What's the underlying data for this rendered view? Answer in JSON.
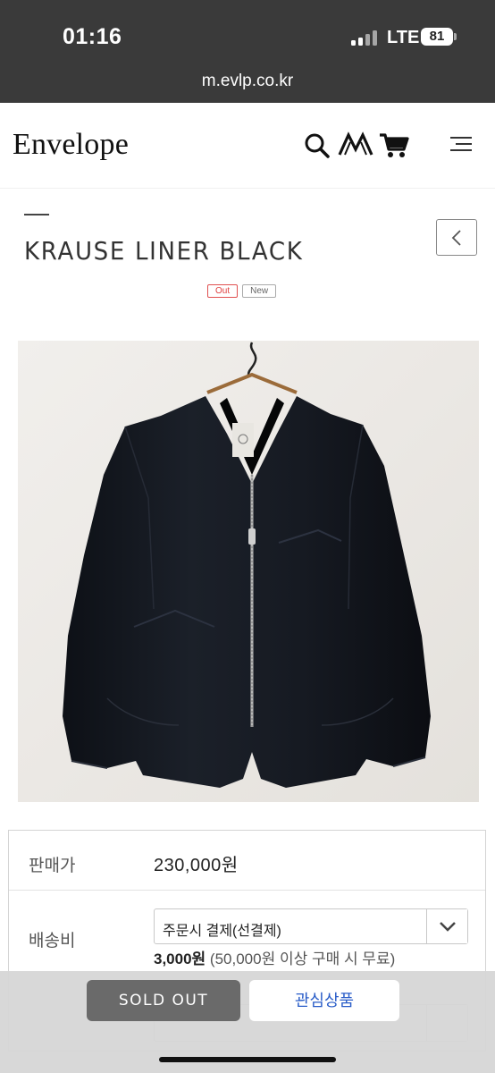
{
  "status_bar": {
    "time": "01:16",
    "network": "LTE",
    "battery": "81"
  },
  "browser": {
    "url": "m.evlp.co.kr"
  },
  "header": {
    "logo": "Envelope",
    "icons": [
      "search-icon",
      "brand-logo-icon",
      "cart-icon",
      "menu-icon"
    ]
  },
  "product": {
    "title": "KRAUSE LINER BLACK",
    "badges": {
      "out": "Out",
      "new": "New"
    },
    "image_alt": "black v-neck zip liner jacket on hanger"
  },
  "info": {
    "price_label": "판매가",
    "price_value": "230,000원",
    "shipping_label": "배송비",
    "shipping_option": "주문시 결제(선결제)",
    "shipping_fee": "3,000원",
    "shipping_note": "(50,000원 이상 구매 시 무료)"
  },
  "actions": {
    "soldout": "SOLD OUT",
    "wishlist": "관심상품"
  },
  "colors": {
    "status_bar_bg": "#3a3a3a",
    "soldout_bg": "#6a6a6a",
    "wishlist_text": "#2a5dc8",
    "out_badge": "#e04040"
  }
}
